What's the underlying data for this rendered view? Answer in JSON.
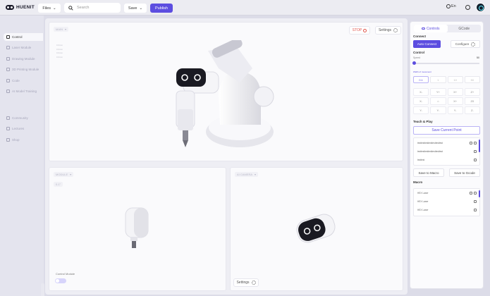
{
  "header": {
    "brand": "HUENIT",
    "files_label": "Files",
    "search_placeholder": "Search",
    "save_label": "Save",
    "publish_label": "Publish",
    "language_label": "En"
  },
  "sidebar": {
    "items": [
      {
        "label": "Control",
        "active": true
      },
      {
        "label": "Laser Module",
        "active": false
      },
      {
        "label": "Drawing Module",
        "active": false
      },
      {
        "label": "3D Printing Module",
        "active": false
      },
      {
        "label": "Code",
        "active": false
      },
      {
        "label": "AI Model Training",
        "active": false
      },
      {
        "label": "Community",
        "active": false
      },
      {
        "label": "Lectures",
        "active": false
      },
      {
        "label": "Shop",
        "active": false
      }
    ]
  },
  "workspace": {
    "main_panel": {
      "tag": "MAIN",
      "stop_label": "STOP",
      "settings_label": "Settings",
      "mini_lines": [
        "0.0mm",
        "0.0mm",
        "0.0mm",
        "0.0mm"
      ]
    },
    "module_panel": {
      "tag": "MODULE",
      "sub_tag": "0.1°",
      "control_module_label": "Control Module"
    },
    "camera_panel": {
      "tag": "AI CAMERA",
      "settings_label": "Settings"
    }
  },
  "controls": {
    "tabs": [
      {
        "label": "Controls",
        "active": true
      },
      {
        "label": "GCode",
        "active": false
      }
    ],
    "connect_title": "Connect",
    "auto_connect_label": "Auto Connect",
    "configure_label": "Configure",
    "control_title": "Control",
    "speed_label": "Speed",
    "speed_value": "50",
    "speed_fraction": 0.02,
    "width_label": "Width of movement",
    "widths": [
      "0.1",
      "1",
      "10",
      "50"
    ],
    "active_width_index": 0,
    "jog_buttons": [
      "X-",
      "Y+",
      "X+",
      "Z+",
      "X-",
      "⌂",
      "X+",
      "Z0",
      "Y-",
      "Y-",
      "Y-",
      "Z-"
    ],
    "teach_title": "Teach & Play",
    "save_point_label": "Save Current Point",
    "points": [
      "testtesttesttesttesttesttest",
      "testtesttesttesttesttesttest",
      "testtest"
    ],
    "save_macro_label": "Save to Macro",
    "save_gcode_label": "Save to Gcode",
    "macro_title": "Macro",
    "macros": [
      "HEX Laser",
      "HEX Laser",
      "HEX Laser"
    ],
    "colors": {
      "accent": "#5c4de0",
      "stop": "#e0544c"
    }
  }
}
